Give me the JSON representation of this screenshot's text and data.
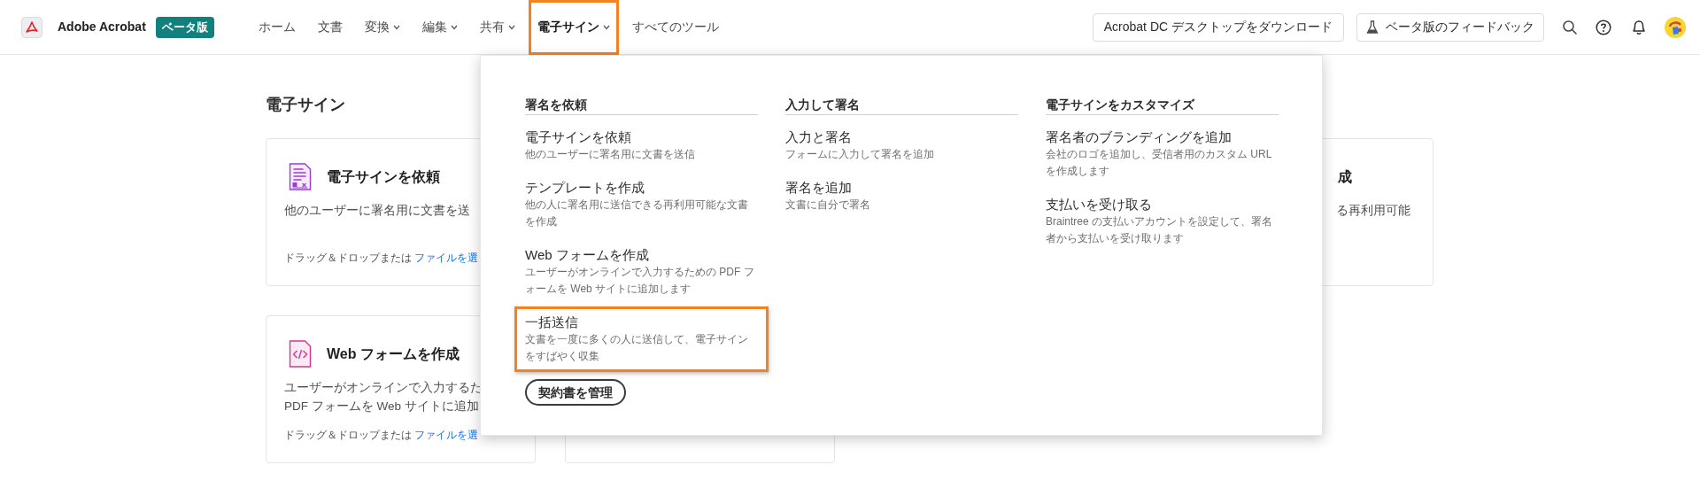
{
  "header": {
    "app_name": "Adobe Acrobat",
    "badge": "ベータ版",
    "nav": [
      {
        "label": "ホーム",
        "has_menu": false,
        "selected": false,
        "highlighted": false
      },
      {
        "label": "文書",
        "has_menu": false,
        "selected": false,
        "highlighted": false
      },
      {
        "label": "変換",
        "has_menu": true,
        "selected": false,
        "highlighted": false
      },
      {
        "label": "編集",
        "has_menu": true,
        "selected": false,
        "highlighted": false
      },
      {
        "label": "共有",
        "has_menu": true,
        "selected": false,
        "highlighted": false
      },
      {
        "label": "電子サイン",
        "has_menu": true,
        "selected": true,
        "highlighted": true
      },
      {
        "label": "すべてのツール",
        "has_menu": false,
        "selected": false,
        "highlighted": false
      }
    ],
    "download_button": "Acrobat DC デスクトップをダウンロード",
    "feedback_button": "ベータ版のフィードバック"
  },
  "page": {
    "title": "電子サイン",
    "rows": [
      {
        "cards": [
          {
            "kind": "request",
            "title": "電子サインを依頼",
            "description": [
              "他のユーザーに署名用に文書を送"
            ],
            "drop_text": "ドラッグ＆ドロップまたは",
            "link": "ファイルを選"
          },
          {
            "kind": "template",
            "title": "成",
            "description": [
              "る再利用可能"
            ]
          }
        ]
      },
      {
        "cards": [
          {
            "kind": "webform",
            "title": "Web フォームを作成",
            "description": [
              "ユーザーがオンラインで入力するた",
              "PDF フォームを Web サイトに追加"
            ],
            "drop_text": "ドラッグ＆ドロップまたは",
            "link": "ファイルを選"
          },
          {
            "kind": "blank"
          }
        ]
      }
    ]
  },
  "menu": {
    "columns": [
      {
        "heading": "署名を依頼",
        "items": [
          {
            "title": "電子サインを依頼",
            "description": [
              "他のユーザーに署名用に文書を送信"
            ],
            "highlighted": false
          },
          {
            "title": "テンプレートを作成",
            "description": [
              "他の人に署名用に送信できる再利用可能な文書",
              "を作成"
            ],
            "highlighted": false
          },
          {
            "title": "Web フォームを作成",
            "description": [
              "ユーザーがオンラインで入力するための PDF フ",
              "ォームを Web サイトに追加します"
            ],
            "highlighted": false
          },
          {
            "title": "一括送信",
            "description": [
              "文書を一度に多くの人に送信して、電子サイン",
              "をすばやく収集"
            ],
            "highlighted": true
          }
        ],
        "button": "契約書を管理"
      },
      {
        "heading": "入力して署名",
        "items": [
          {
            "title": "入力と署名",
            "description": [
              "フォームに入力して署名を追加"
            ],
            "highlighted": false
          },
          {
            "title": "署名を追加",
            "description": [
              "文書に自分で署名"
            ],
            "highlighted": false
          }
        ]
      },
      {
        "heading": "電子サインをカスタマイズ",
        "items": [
          {
            "title": "署名者のブランディングを追加",
            "description": [
              "会社のロゴを追加し、受信者用のカスタム URL",
              "を作成します"
            ],
            "highlighted": false
          },
          {
            "title": "支払いを受け取る",
            "description": [
              "Braintree の支払いアカウントを設定して、署名",
              "者から支払いを受け取ります"
            ],
            "highlighted": false
          }
        ]
      }
    ]
  }
}
